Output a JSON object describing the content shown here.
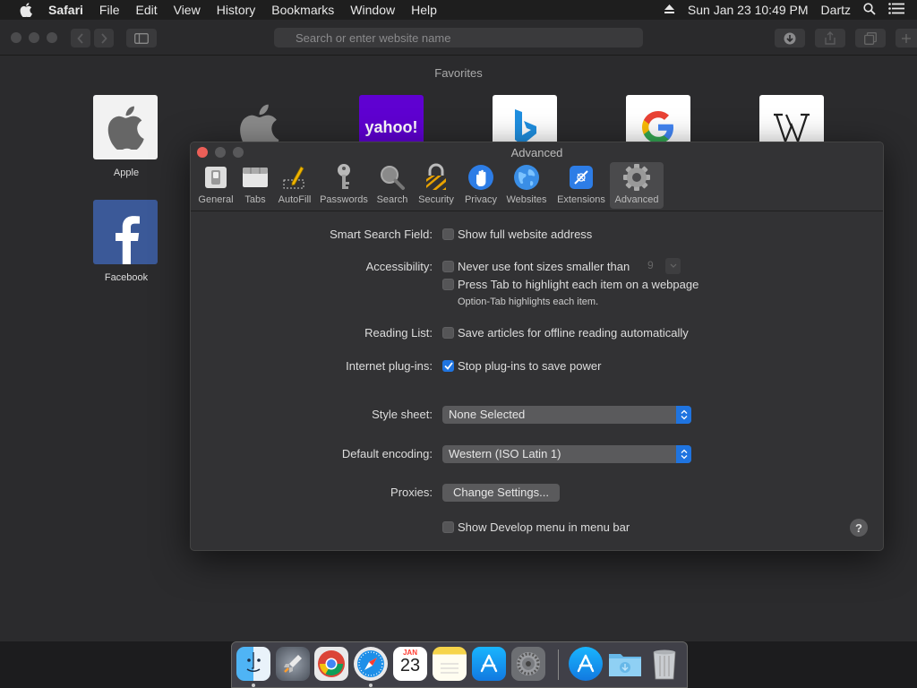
{
  "menubar": {
    "app": "Safari",
    "items": [
      "File",
      "Edit",
      "View",
      "History",
      "Bookmarks",
      "Window",
      "Help"
    ],
    "clock": "Sun Jan 23  10:49 PM",
    "user": "Dartz"
  },
  "toolbar": {
    "address_placeholder": "Search or enter website name"
  },
  "favorites": {
    "title": "Favorites",
    "items": [
      {
        "label": "Apple"
      },
      {
        "label": "Facebook"
      }
    ],
    "yahoo_logo": "yahoo!"
  },
  "prefs": {
    "title": "Advanced",
    "tabs": [
      {
        "label": "General",
        "icon": "switch-icon"
      },
      {
        "label": "Tabs",
        "icon": "tabs-icon"
      },
      {
        "label": "AutoFill",
        "icon": "pencil-icon"
      },
      {
        "label": "Passwords",
        "icon": "key-icon"
      },
      {
        "label": "Search",
        "icon": "magnifier-icon"
      },
      {
        "label": "Security",
        "icon": "lock-icon"
      },
      {
        "label": "Privacy",
        "icon": "hand-icon"
      },
      {
        "label": "Websites",
        "icon": "globe-icon"
      },
      {
        "label": "Extensions",
        "icon": "puzzle-icon"
      },
      {
        "label": "Advanced",
        "icon": "gear-icon",
        "selected": true
      }
    ],
    "smart_search": {
      "label": "Smart Search Field:",
      "option": "Show full website address",
      "checked": false
    },
    "accessibility": {
      "label": "Accessibility:",
      "option1": "Never use font sizes smaller than",
      "font_size": "9",
      "option2": "Press Tab to highlight each item on a webpage",
      "hint": "Option-Tab highlights each item."
    },
    "reading_list": {
      "label": "Reading List:",
      "option": "Save articles for offline reading automatically"
    },
    "plugins": {
      "label": "Internet plug-ins:",
      "option": "Stop plug-ins to save power",
      "checked": true
    },
    "style_sheet": {
      "label": "Style sheet:",
      "value": "None Selected"
    },
    "encoding": {
      "label": "Default encoding:",
      "value": "Western (ISO Latin 1)"
    },
    "proxies": {
      "label": "Proxies:",
      "button": "Change Settings..."
    },
    "develop": {
      "option": "Show Develop menu in menu bar"
    },
    "help": "?"
  },
  "dock": {
    "calendar_month": "JAN",
    "calendar_day": "23"
  },
  "colors": {
    "accent": "#1f74e0",
    "close": "#ec5f58"
  }
}
